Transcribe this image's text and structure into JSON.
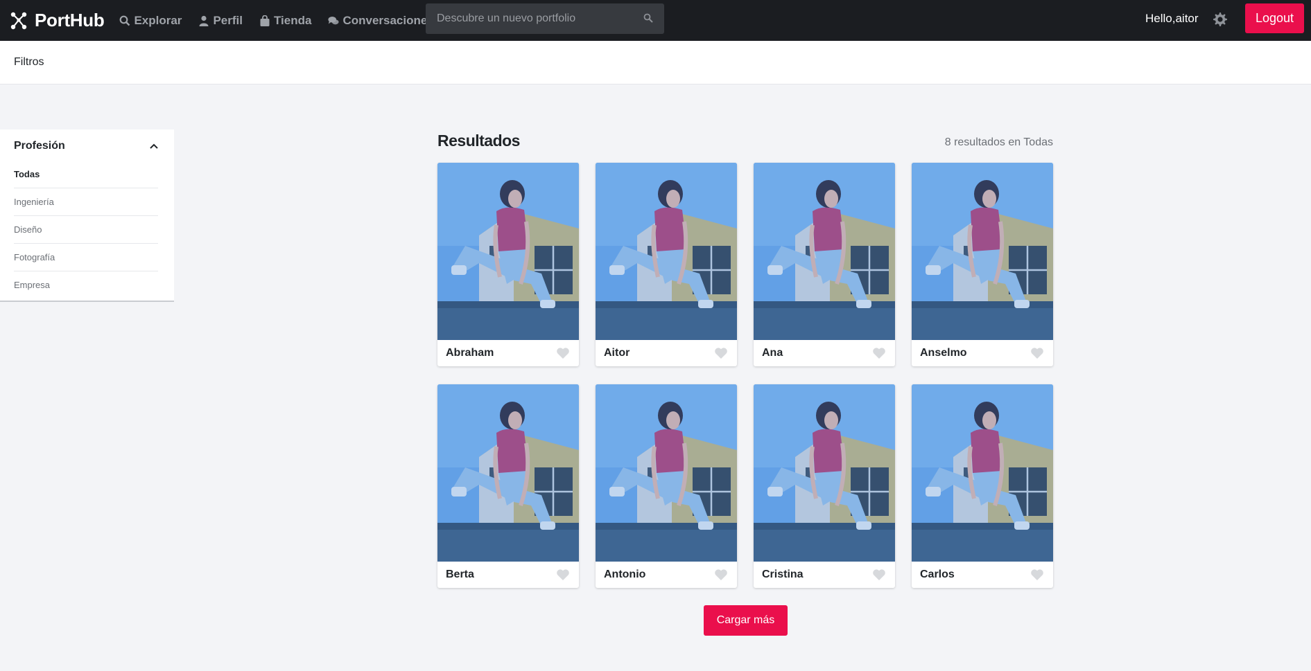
{
  "navbar": {
    "brand": "PortHub",
    "links": [
      {
        "label": "Explorar",
        "icon": "search-icon"
      },
      {
        "label": "Perfil",
        "icon": "user-icon"
      },
      {
        "label": "Tienda",
        "icon": "shopping-bag-icon"
      },
      {
        "label": "Conversaciones",
        "icon": "chat-icon"
      }
    ],
    "search_placeholder": "Descubre un nuevo portfolio",
    "hello": "Hello,aitor",
    "logout": "Logout"
  },
  "filters_bar": {
    "title": "Filtros"
  },
  "sidebar": {
    "title": "Profesión",
    "items": [
      {
        "label": "Todas",
        "active": true
      },
      {
        "label": "Ingeniería",
        "active": false
      },
      {
        "label": "Diseño",
        "active": false
      },
      {
        "label": "Fotografía",
        "active": false
      },
      {
        "label": "Empresa",
        "active": false
      }
    ]
  },
  "results": {
    "title": "Resultados",
    "count": "8 resultados en Todas",
    "cards": [
      {
        "name": "Abraham"
      },
      {
        "name": "Aitor"
      },
      {
        "name": "Ana"
      },
      {
        "name": "Anselmo"
      },
      {
        "name": "Berta"
      },
      {
        "name": "Antonio"
      },
      {
        "name": "Cristina"
      },
      {
        "name": "Carlos"
      }
    ],
    "load_more": "Cargar más"
  },
  "colors": {
    "navbar_bg": "#1b1d21",
    "accent": "#ea0f4c",
    "page_bg": "#f3f4f7",
    "photo_overlay": "#4a8fe0"
  }
}
